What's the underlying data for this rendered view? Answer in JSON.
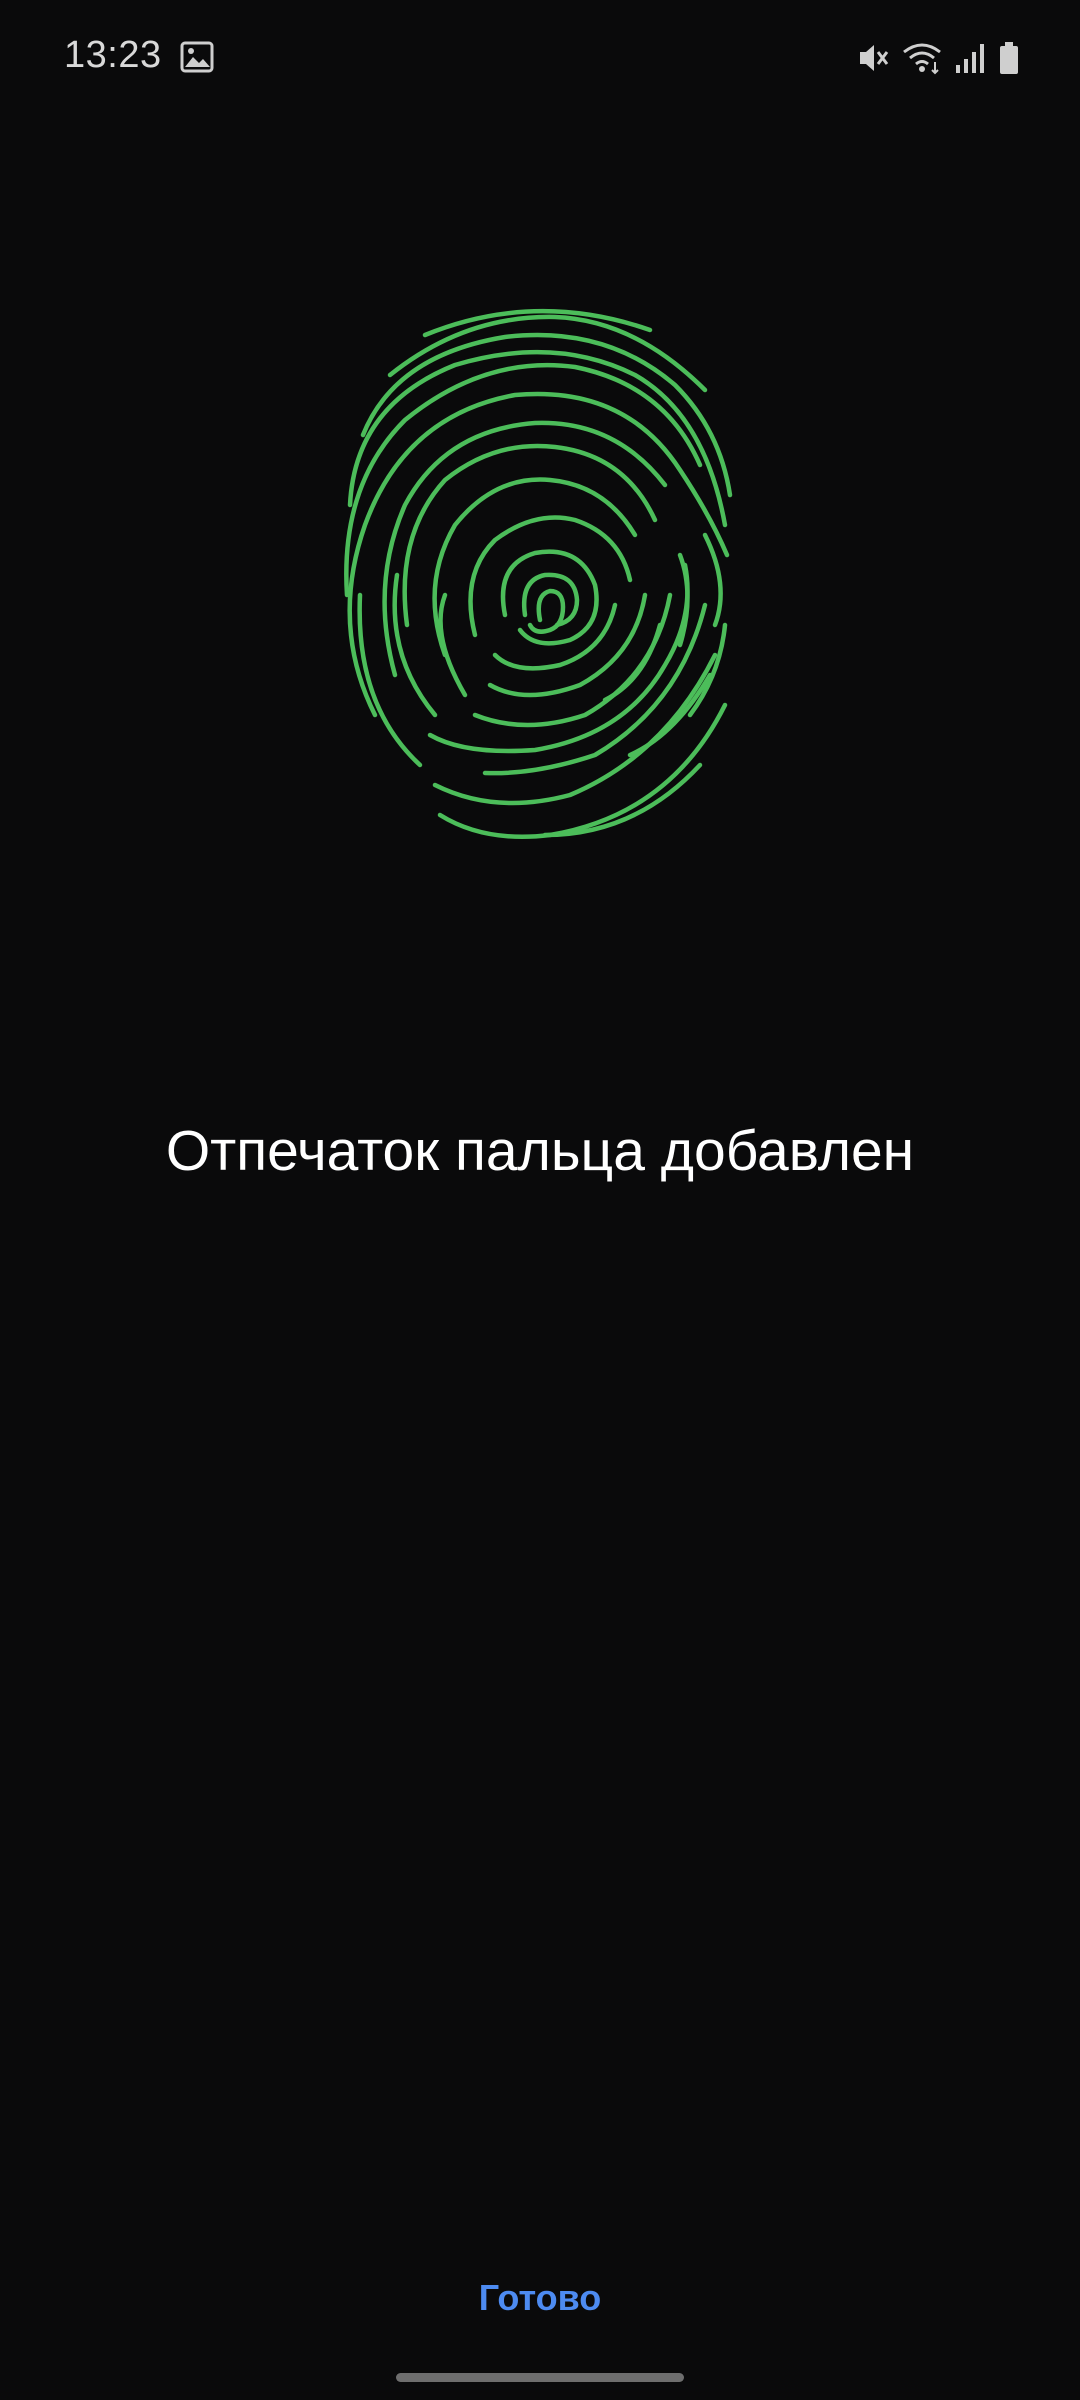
{
  "status_bar": {
    "time": "13:23",
    "left_icons": [
      "image-icon"
    ],
    "right_icons": [
      "mute-icon",
      "wifi-icon",
      "signal-icon",
      "battery-icon"
    ]
  },
  "main": {
    "title": "Отпечаток пальца добавлен",
    "fingerprint_icon": "fingerprint-icon",
    "fingerprint_color": "#4cbd5a"
  },
  "footer": {
    "done_label": "Готово",
    "done_color": "#4d8bf1"
  }
}
